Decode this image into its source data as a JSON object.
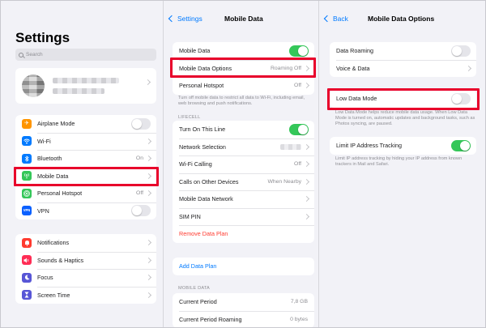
{
  "settings": {
    "title": "Settings",
    "search_placeholder": "Search",
    "group1": [
      {
        "label": "Airplane Mode",
        "icon": "airplane-icon",
        "color": "#ff9500"
      },
      {
        "label": "Wi-Fi",
        "value": "",
        "icon": "wifi-icon",
        "color": "#007aff"
      },
      {
        "label": "Bluetooth",
        "value": "On",
        "icon": "bluetooth-icon",
        "color": "#007aff"
      },
      {
        "label": "Mobile Data",
        "icon": "antenna-icon",
        "color": "#34c759"
      },
      {
        "label": "Personal Hotspot",
        "value": "Off",
        "icon": "hotspot-icon",
        "color": "#34c759"
      },
      {
        "label": "VPN",
        "icon": "vpn-icon",
        "color": "#0a60ff"
      }
    ],
    "group2": [
      {
        "label": "Notifications",
        "icon": "bell-icon",
        "color": "#ff3b30"
      },
      {
        "label": "Sounds & Haptics",
        "icon": "speaker-icon",
        "color": "#ff2d55"
      },
      {
        "label": "Focus",
        "icon": "moon-icon",
        "color": "#5856d6"
      },
      {
        "label": "Screen Time",
        "icon": "hourglass-icon",
        "color": "#5856d6"
      }
    ]
  },
  "mobile_data": {
    "back_label": "Settings",
    "title": "Mobile Data",
    "group1": [
      {
        "label": "Mobile Data"
      },
      {
        "label": "Mobile Data Options",
        "value": "Roaming Off"
      },
      {
        "label": "Personal Hotspot",
        "value": "Off"
      }
    ],
    "group1_footer": "Turn off mobile data to restrict all data to Wi-Fi, including email, web browsing and push notifications.",
    "lifecell_header": "LIFECELL",
    "group2": [
      {
        "label": "Turn On This Line"
      },
      {
        "label": "Network Selection"
      },
      {
        "label": "Wi-Fi Calling",
        "value": "Off"
      },
      {
        "label": "Calls on Other Devices",
        "value": "When Nearby"
      },
      {
        "label": "Mobile Data Network"
      },
      {
        "label": "SIM PIN"
      },
      {
        "label": "Remove Data Plan"
      }
    ],
    "add_plan": "Add Data Plan",
    "mobile_data_header": "MOBILE DATA",
    "group3": [
      {
        "label": "Current Period",
        "value": "7,8 GB"
      },
      {
        "label": "Current Period Roaming",
        "value": "0 bytes"
      }
    ]
  },
  "options": {
    "back_label": "Back",
    "title": "Mobile Data Options",
    "group1": [
      {
        "label": "Data Roaming"
      },
      {
        "label": "Voice & Data"
      }
    ],
    "low_data_label": "Low Data Mode",
    "low_data_footer": "Low Data Mode helps reduce mobile data usage. When Low Data Mode is turned on, automatic updates and background tasks, such as Photos syncing, are paused.",
    "limit_ip_label": "Limit IP Address Tracking",
    "limit_ip_footer": "Limit IP address tracking by hiding your IP address from known trackers in Mail and Safari."
  },
  "toggles": {
    "airplane_mode": false,
    "vpn": false,
    "mobile_data": true,
    "turn_on_this_line": true,
    "wifi_calling": false,
    "data_roaming": false,
    "low_data_mode": false,
    "limit_ip_tracking": true
  },
  "colors": {
    "accent": "#007aff",
    "toggle_on": "#34c759",
    "highlight": "#e8002b",
    "destructive": "#ff3b30"
  }
}
